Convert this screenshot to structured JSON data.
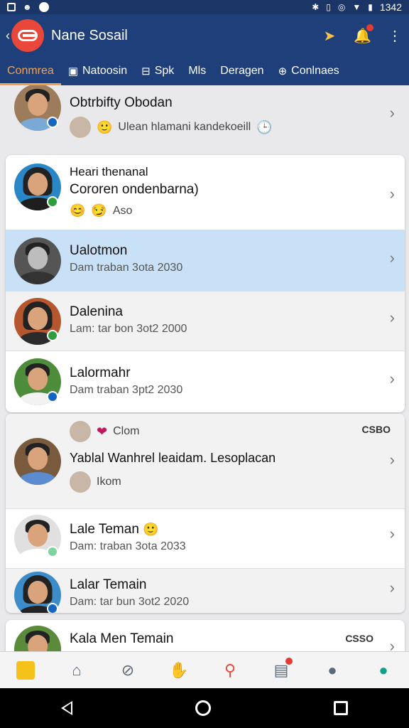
{
  "status_bar": {
    "time": "1342"
  },
  "app_bar": {
    "title": "Nane Sosail"
  },
  "tabs": [
    {
      "label": "Conmrea"
    },
    {
      "label": "Natoosin"
    },
    {
      "label": "Spk"
    },
    {
      "label": "Mls"
    },
    {
      "label": "Deragen"
    },
    {
      "label": "Conlnaes"
    }
  ],
  "items": [
    {
      "name": "Obtrbifty Obodan",
      "sub": "Ulean hlamani kandekoeill"
    },
    {
      "name": "Heari thenanal",
      "sub": "Cororen ondenbarna)",
      "extra": "Aso"
    },
    {
      "name": "Ualotmon",
      "sub": "Dam traban 3ota 2030"
    },
    {
      "name": "Dalenina",
      "sub": "Lam: tar bon 3ot2 2000"
    },
    {
      "name": "Lalormahr",
      "sub": "Dam traban 3pt2 2030"
    },
    {
      "name": "Yablal Wanhrel leaidam. Lesoplacan",
      "top_label": "Clom",
      "sub": "Ikom",
      "tag": "CSBO"
    },
    {
      "name": "Lale Teman",
      "sub": "Dam: traban 3ota 2033"
    },
    {
      "name": "Lalar Temain",
      "sub": "Dam: tar bun 3ot2 2020"
    },
    {
      "name": "Kala Men Temain",
      "tag": "CSSO"
    }
  ],
  "colors": {
    "header": "#1f3f7a",
    "accent": "#f6a24a",
    "highlight_row": "#c9e1f7",
    "active_nav": "#13a08a"
  },
  "icons": {
    "app_bar": [
      "send-icon",
      "bell-icon",
      "more-vert-icon"
    ],
    "bottom_nav": [
      "apps-icon",
      "home-icon",
      "explore-icon",
      "pets-icon",
      "location-pin-icon",
      "media-icon",
      "person-icon",
      "account-icon"
    ]
  }
}
